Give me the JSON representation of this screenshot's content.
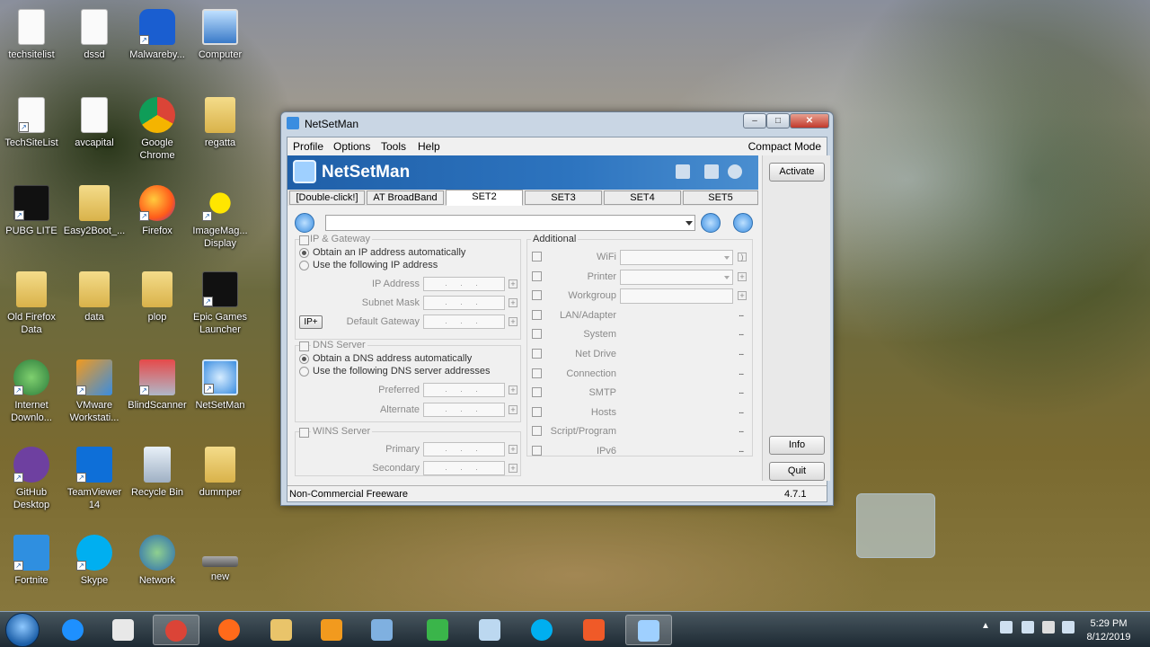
{
  "desktop": {
    "icons": [
      {
        "label": "techsitelist",
        "icon": "document-icon"
      },
      {
        "label": "dssd",
        "icon": "document-icon"
      },
      {
        "label": "Malwareby...",
        "icon": "malwarebytes-icon"
      },
      {
        "label": "Computer",
        "icon": "computer-icon"
      },
      {
        "label": "TechSiteList",
        "icon": "document-icon"
      },
      {
        "label": "avcapital",
        "icon": "document-icon"
      },
      {
        "label": "Google Chrome",
        "icon": "chrome-icon"
      },
      {
        "label": "regatta",
        "icon": "folder-icon"
      },
      {
        "label": "PUBG LITE",
        "icon": "pubg-icon"
      },
      {
        "label": "Easy2Boot_...",
        "icon": "folder-icon"
      },
      {
        "label": "Firefox",
        "icon": "firefox-icon"
      },
      {
        "label": "ImageMag... Display",
        "icon": "imagemagick-icon"
      },
      {
        "label": "Old Firefox Data",
        "icon": "folder-icon"
      },
      {
        "label": "data",
        "icon": "folder-icon"
      },
      {
        "label": "plop",
        "icon": "folder-icon"
      },
      {
        "label": "Epic Games Launcher",
        "icon": "epic-games-icon"
      },
      {
        "label": "Internet Downlo...",
        "icon": "idm-icon"
      },
      {
        "label": "VMware Workstati...",
        "icon": "vmware-icon"
      },
      {
        "label": "BlindScanner",
        "icon": "scanner-icon"
      },
      {
        "label": "NetSetMan",
        "icon": "netsetman-icon"
      },
      {
        "label": "GitHub Desktop",
        "icon": "github-icon"
      },
      {
        "label": "TeamViewer 14",
        "icon": "teamviewer-icon"
      },
      {
        "label": "Recycle Bin",
        "icon": "recycle-bin-icon"
      },
      {
        "label": "dummper",
        "icon": "folder-icon"
      },
      {
        "label": "Fortnite",
        "icon": "fortnite-icon"
      },
      {
        "label": "Skype",
        "icon": "skype-icon"
      },
      {
        "label": "Network",
        "icon": "network-icon"
      },
      {
        "label": "new",
        "icon": "drive-icon"
      }
    ]
  },
  "window": {
    "title": "NetSetMan",
    "menu": {
      "profile": "Profile",
      "options": "Options",
      "tools": "Tools",
      "help": "Help",
      "compact": "Compact Mode"
    },
    "banner_title": "NetSetMan",
    "tabs": [
      "[Double-click!]",
      "AT BroadBand",
      "SET2",
      "SET3",
      "SET4",
      "SET5"
    ],
    "active_tab": "SET2",
    "buttons": {
      "activate": "Activate",
      "info": "Info",
      "quit": "Quit"
    },
    "ip": {
      "group": "IP & Gateway",
      "auto": "Obtain an IP address automatically",
      "manual": "Use the following IP address",
      "ip_address": "IP Address",
      "subnet": "Subnet Mask",
      "gateway": "Default Gateway",
      "ip_plus": "IP+"
    },
    "dns": {
      "group": "DNS Server",
      "auto": "Obtain a DNS address automatically",
      "manual": "Use the following DNS server addresses",
      "preferred": "Preferred",
      "alternate": "Alternate"
    },
    "wins": {
      "group": "WINS Server",
      "primary": "Primary",
      "secondary": "Secondary"
    },
    "ip_placeholder": ". . .",
    "additional": {
      "group": "Additional",
      "items": [
        "WiFi",
        "Printer",
        "Workgroup",
        "LAN/Adapter",
        "System",
        "Net Drive",
        "Connection",
        "SMTP",
        "Hosts",
        "Script/Program",
        "IPv6"
      ],
      "more": "..."
    },
    "status_text": "Non-Commercial Freeware",
    "version": "4.7.1"
  },
  "taskbar": {
    "time": "5:29 PM",
    "date": "8/12/2019",
    "apps": [
      "internet-explorer-icon",
      "media-player-icon",
      "chrome-icon",
      "firefox-icon",
      "explorer-icon",
      "vmware-icon",
      "remote-desktop-icon",
      "camtasia-icon",
      "notepad-icon",
      "skype-icon",
      "camtasia-recorder-icon",
      "netsetman-icon"
    ]
  }
}
